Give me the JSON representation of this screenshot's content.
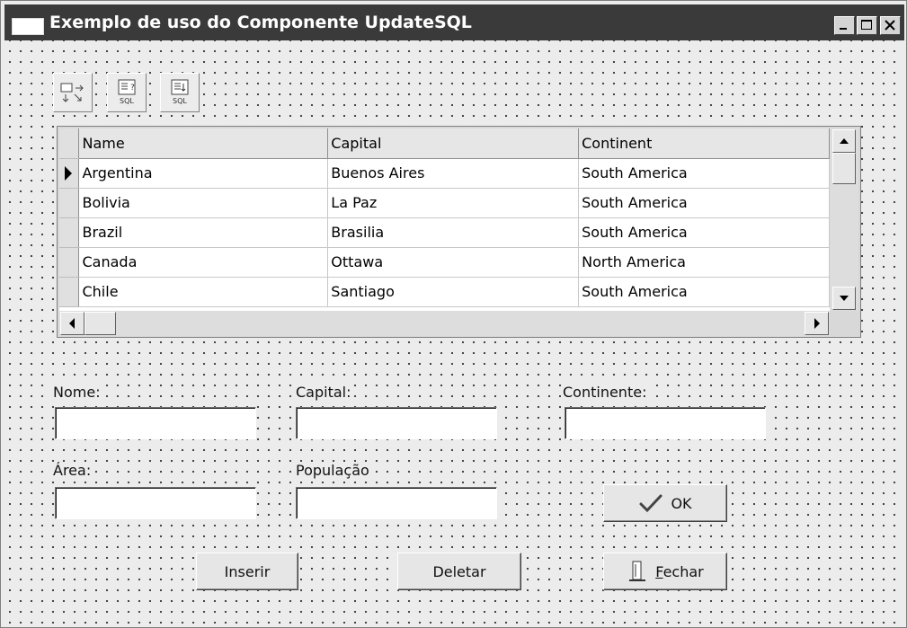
{
  "window": {
    "title": "Exemplo de uso do Componente UpdateSQL"
  },
  "titlebar_buttons": [
    "minimize",
    "maximize",
    "close"
  ],
  "toolbar": {
    "buttons": [
      {
        "icon": "update-table-icon"
      },
      {
        "icon": "sql-query-icon",
        "label": "SQL"
      },
      {
        "icon": "sql-modify-icon",
        "label": "SQL"
      }
    ]
  },
  "grid": {
    "columns": [
      "Name",
      "Capital",
      "Continent"
    ],
    "rows": [
      {
        "name": "Argentina",
        "capital": "Buenos Aires",
        "continent": "South America",
        "current": true
      },
      {
        "name": "Bolivia",
        "capital": "La Paz",
        "continent": "South America"
      },
      {
        "name": "Brazil",
        "capital": "Brasilia",
        "continent": "South America"
      },
      {
        "name": "Canada",
        "capital": "Ottawa",
        "continent": "North America"
      },
      {
        "name": "Chile",
        "capital": "Santiago",
        "continent": "South America"
      }
    ]
  },
  "form": {
    "nome_label": "Nome:",
    "capital_label": "Capital:",
    "continente_label": "Continente:",
    "area_label": "Área:",
    "populacao_label": "População",
    "nome_value": "",
    "capital_value": "",
    "continente_value": "",
    "area_value": "",
    "populacao_value": ""
  },
  "buttons": {
    "ok": "OK",
    "inserir": "Inserir",
    "deletar": "Deletar",
    "fechar_accel": "F",
    "fechar_rest": "echar"
  },
  "colors": {
    "titlebar": "#3a3a3a",
    "face": "#ececec"
  }
}
